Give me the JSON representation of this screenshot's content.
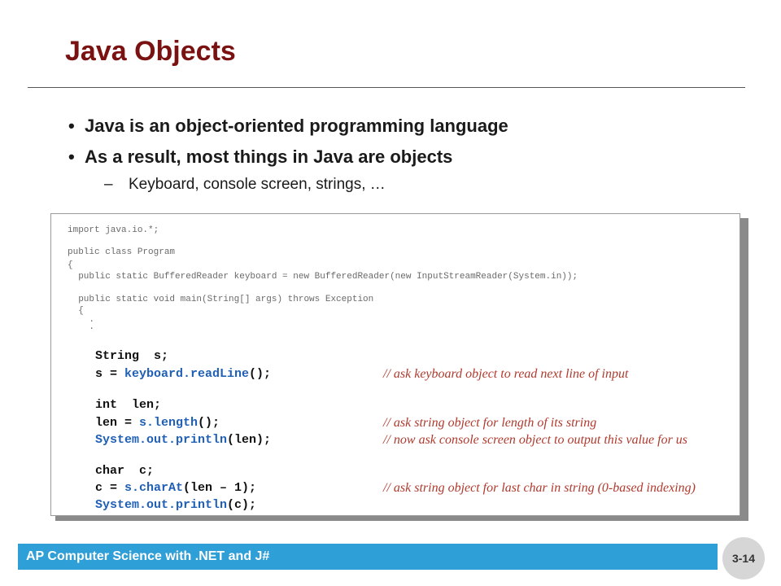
{
  "slide": {
    "title": "Java Objects",
    "bullets": [
      "Java is an object-oriented programming language",
      "As a result, most things in Java are objects"
    ],
    "bullet_marker": "•",
    "sub_bullet": {
      "marker": "–",
      "text": "Keyboard, console screen, strings, …"
    }
  },
  "code": {
    "header_lines": [
      "import java.io.*;",
      "public class Program",
      "{",
      "  public static BufferedReader keyboard = new BufferedReader(new InputStreamReader(System.in));",
      "  public static void main(String[] args) throws Exception",
      "  {",
      "    .",
      "    ."
    ],
    "lines": {
      "l1": "String  s;",
      "l2a": "s = ",
      "l2b": "keyboard.readLine",
      "l2c": "();",
      "l3": "int  len;",
      "l4a": "len = ",
      "l4b": "s.length",
      "l4c": "();",
      "l5a": "System.out.println",
      "l5b": "(len);",
      "l6": "char  c;",
      "l7a": "c = ",
      "l7b": "s.charAt",
      "l7c": "(len – 1);",
      "l8a": "System.out.println",
      "l8b": "(c);"
    },
    "comments": {
      "c1": "// ask keyboard object to read next line of input",
      "c2": "// ask string object for length of its string",
      "c3": "// now ask console screen object to output this value for us",
      "c4": "// ask string object for last char in string (0-based indexing)"
    }
  },
  "footer": {
    "text": "AP Computer Science with .NET and J#",
    "page": "3-14"
  },
  "colors": {
    "title": "#7a1212",
    "footer_bar": "#2f9fd8",
    "code_blue": "#1f5fb5",
    "comment": "#b03a2e"
  }
}
